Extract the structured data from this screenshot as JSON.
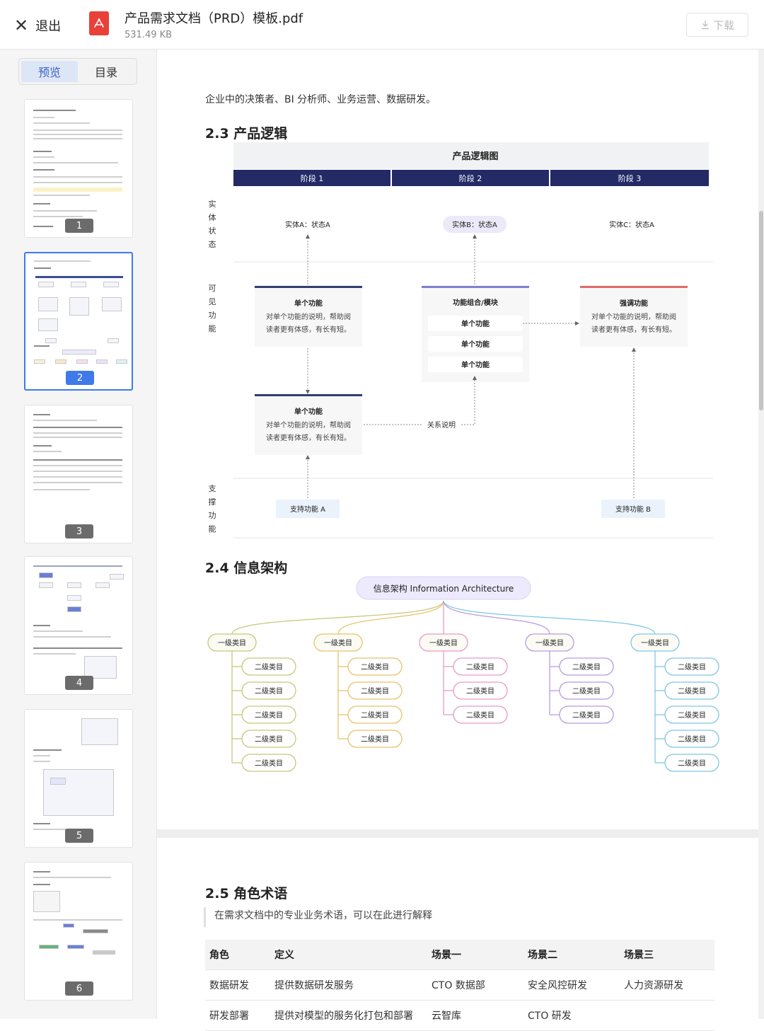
{
  "topbar": {
    "exit_label": "退出",
    "file_name": "产品需求文档（PRD）模板.pdf",
    "file_size": "531.49 KB",
    "download_label": "下载"
  },
  "sidebar": {
    "tabs": [
      {
        "label": "预览",
        "active": true
      },
      {
        "label": "目录",
        "active": false
      }
    ],
    "pages": [
      "1",
      "2",
      "3",
      "4",
      "5",
      "6"
    ],
    "active_page": "2"
  },
  "doc": {
    "intro_text": "企业中的决策者、BI 分析师、业务运营、数据研发。",
    "section_2_3": "2.3 产品逻辑",
    "section_2_4": "2.4 信息架构",
    "section_2_5": "2.5 角色术语",
    "terms_note": "在需求文档中的专业业务术语，可以在此进行解释"
  },
  "logic_diagram": {
    "title": "产品逻辑图",
    "stages": [
      "阶段 1",
      "阶段 2",
      "阶段 3"
    ],
    "row_labels": [
      "实体状态",
      "可见功能",
      "支撑功能"
    ],
    "entities": [
      "实体A：状态A",
      "实体B：状态A",
      "实体C：状态A"
    ],
    "card1": {
      "title": "单个功能",
      "desc1": "对单个功能的说明，帮助阅",
      "desc2": "读者更有体感，有长有短。"
    },
    "card2": {
      "title": "功能组合/模块",
      "items": [
        "单个功能",
        "单个功能",
        "单个功能"
      ]
    },
    "card3": {
      "title": "强调功能",
      "desc1": "对单个功能的说明，帮助阅",
      "desc2": "读者更有体感，有长有短。"
    },
    "card4": {
      "title": "单个功能",
      "desc1": "对单个功能的说明，帮助阅",
      "desc2": "读者更有体感，有长有短。"
    },
    "relation_label": "关系说明",
    "support": [
      "支持功能 A",
      "支持功能 B"
    ],
    "colors": {
      "stage_bar": "#232a66",
      "card_top": "#2f3f6e",
      "module_top": "#7f7fd0",
      "emphasis_top": "#e06b6b"
    }
  },
  "info_arch": {
    "root": "信息架构 Information Architecture",
    "branches": [
      {
        "label": "一级类目",
        "color": "#c6c87a",
        "children": [
          "二级类目",
          "二级类目",
          "二级类目",
          "二级类目",
          "二级类目"
        ]
      },
      {
        "label": "一级类目",
        "color": "#e8c26a",
        "children": [
          "二级类目",
          "二级类目",
          "二级类目",
          "二级类目"
        ]
      },
      {
        "label": "一级类目",
        "color": "#e79bc6",
        "children": [
          "二级类目",
          "二级类目",
          "二级类目"
        ]
      },
      {
        "label": "一级类目",
        "color": "#b99bde",
        "children": [
          "二级类目",
          "二级类目",
          "二级类目"
        ]
      },
      {
        "label": "一级类目",
        "color": "#7fc6e3",
        "children": [
          "二级类目",
          "二级类目",
          "二级类目",
          "二级类目",
          "二级类目"
        ]
      }
    ]
  },
  "terms_table": {
    "headers": [
      "角色",
      "定义",
      "场景一",
      "场景二",
      "场景三"
    ],
    "rows": [
      [
        "数据研发",
        "提供数据研发服务",
        "CTO 数据部",
        "安全风控研发",
        "人力资源研发"
      ],
      [
        "研发部署",
        "提供对模型的服务化打包和部署",
        "云智库",
        "CTO 研发",
        ""
      ]
    ]
  }
}
